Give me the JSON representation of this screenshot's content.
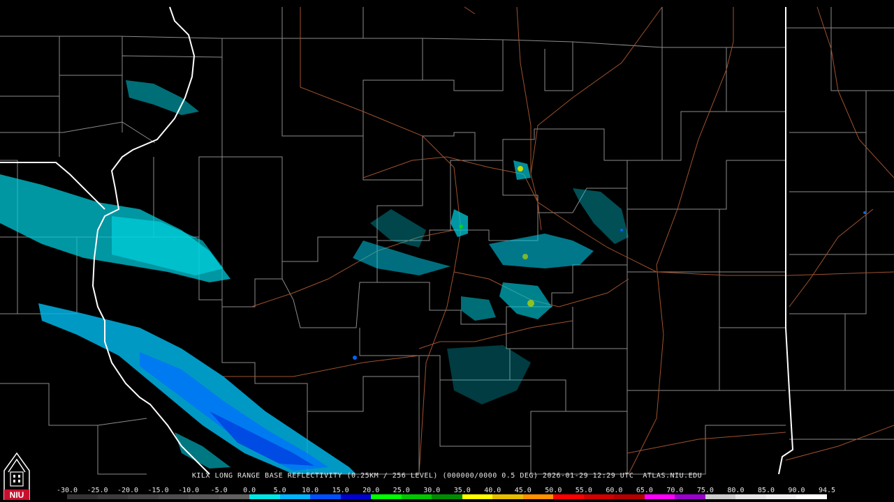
{
  "product_caption": "KILX LONG RANGE BASE REFLECTIVITY (0.25KM / 256 LEVEL) (000000/0000 0.5 DEG) 2026-01-29 12:29 UTC  ATLAS.NIU.EDU",
  "logo_text": "NIU",
  "scale": {
    "labels": [
      "-30.0",
      "-25.0",
      "-20.0",
      "-15.0",
      "-10.0",
      "-5.0",
      "0.0",
      "5.0",
      "10.0",
      "15.0",
      "20.0",
      "25.0",
      "30.0",
      "35.0",
      "40.0",
      "45.0",
      "50.0",
      "55.0",
      "60.0",
      "65.0",
      "70.0",
      "75.0",
      "80.0",
      "85.0",
      "90.0",
      "94.5"
    ],
    "colors": [
      "#333333",
      "#3c3c3c",
      "#454545",
      "#4e4e4e",
      "#575757",
      "#606060",
      "#00e6e6",
      "#00b4ff",
      "#0050ff",
      "#0000d0",
      "#00ff00",
      "#00c800",
      "#008c00",
      "#ffff00",
      "#e6be00",
      "#ff9000",
      "#ff0000",
      "#d20000",
      "#b40000",
      "#ff00ff",
      "#9900cc",
      "#cccccc",
      "#e6e6e6",
      "#f0f0f0",
      "#ffffff"
    ]
  },
  "colors": {
    "background": "#000000",
    "county_border": "#8c8c8c",
    "state_border": "#ffffff",
    "highway": "#a0522d"
  }
}
